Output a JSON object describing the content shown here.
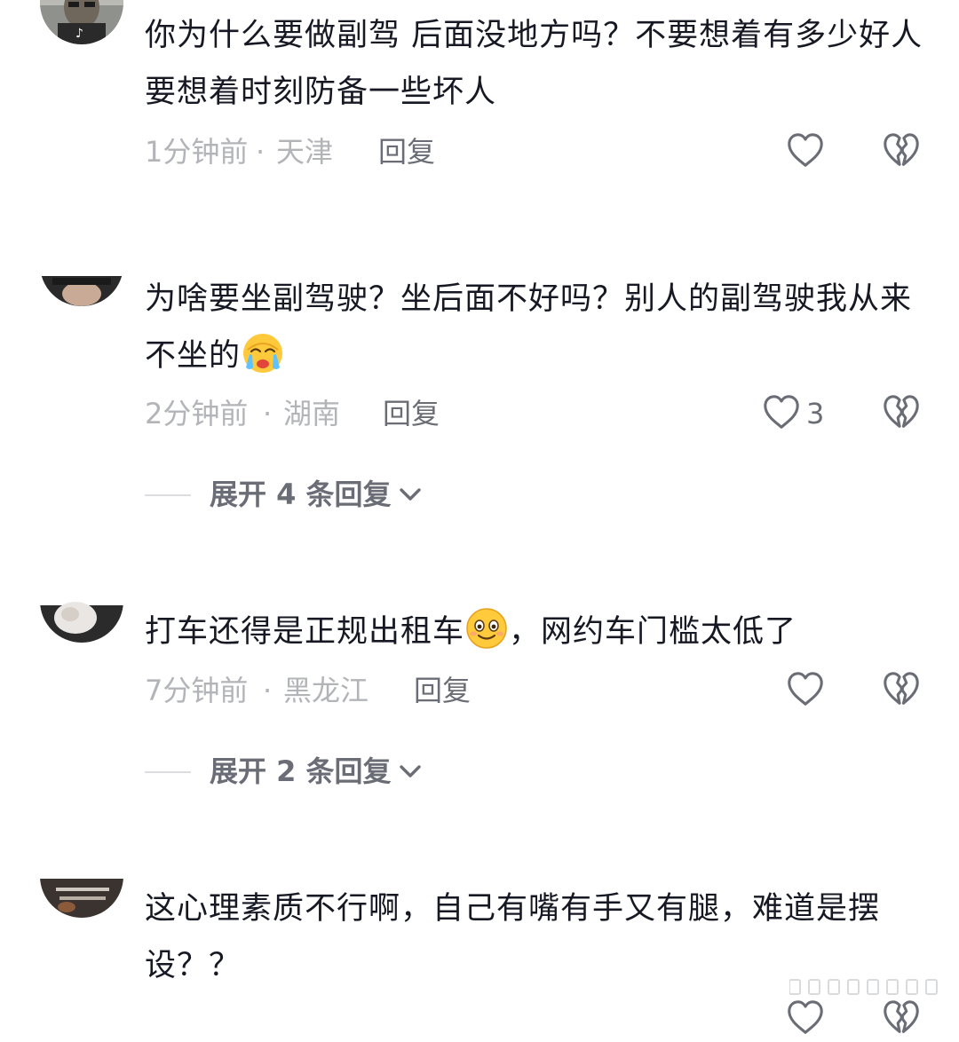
{
  "comments": [
    {
      "text": "你为什么要做副驾 后面没地方吗？不要想着有多少好人 要想着时刻防备一些坏人",
      "time": "1分钟前",
      "sep": "·",
      "location": "天津",
      "reply_label": "回复",
      "like_count": "",
      "like_icon": "heart-outline",
      "dislike_icon": "broken-heart"
    },
    {
      "text": "为啥要坐副驾驶？坐后面不好吗？别人的副驾驶我从来不坐的",
      "emoji": "crying-face",
      "time": "2分钟前",
      "sep": "·",
      "location": "湖南",
      "reply_label": "回复",
      "like_count": "3",
      "like_icon": "heart-outline",
      "dislike_icon": "broken-heart",
      "expand_label": "展开 4 条回复",
      "expand_icon": "chevron-down"
    },
    {
      "text_before": "打车还得是正规出租车",
      "emoji": "smiling-face",
      "text_after": "，网约车门槛太低了",
      "time": "7分钟前",
      "sep": "·",
      "location": "黑龙江",
      "reply_label": "回复",
      "like_count": "",
      "like_icon": "heart-outline",
      "dislike_icon": "broken-heart",
      "expand_label": "展开 2 条回复",
      "expand_icon": "chevron-down"
    },
    {
      "text": "这心理素质不行啊，自己有嘴有手又有腿，难道是摆设？？",
      "like_icon": "heart-outline",
      "dislike_icon": "broken-heart"
    }
  ],
  "colors": {
    "text_primary": "#161823",
    "text_meta": "#b3b4b8",
    "text_action": "#6b6d76",
    "icon_stroke": "#6b6d76",
    "divider": "#dcdde0"
  }
}
